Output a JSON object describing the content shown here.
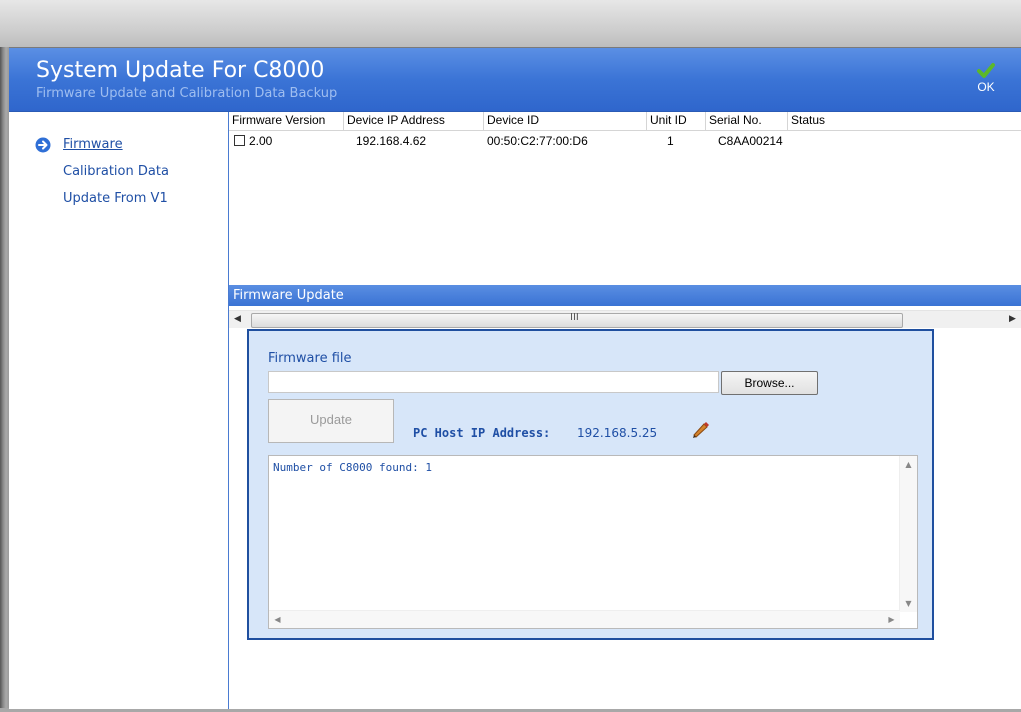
{
  "header": {
    "title": "System Update For C8000",
    "subtitle": "Firmware Update and Calibration Data Backup",
    "ok_label": "OK"
  },
  "sidebar": {
    "items": [
      {
        "label": "Firmware",
        "active": true
      },
      {
        "label": "Calibration Data",
        "active": false
      },
      {
        "label": "Update From V1",
        "active": false
      }
    ]
  },
  "device_table": {
    "columns": [
      "Firmware Version",
      "Device IP Address",
      "Device ID",
      "Unit ID",
      "Serial No.",
      "Status"
    ],
    "rows": [
      {
        "firmware_version": "2.00",
        "checked": false,
        "ip": "192.168.4.62",
        "device_id": "00:50:C2:77:00:D6",
        "unit_id": "1",
        "serial": "C8AA00214",
        "status": ""
      }
    ],
    "scroll_grip": "III"
  },
  "firmware_update": {
    "section_title": "Firmware Update",
    "file_label": "Firmware file",
    "file_value": "",
    "browse_label": "Browse...",
    "update_label": "Update",
    "host_label": "PC Host IP Address:",
    "host_value": "192.168.5.25",
    "log_text": "Number of C8000 found: 1"
  },
  "colors": {
    "header_blue": "#3b74d6",
    "link_blue": "#1f4fa5",
    "panel_bg": "#d7e6f9",
    "panel_border": "#1f4f9f",
    "ok_check": "#5cb82a"
  },
  "icons": {
    "ok": "check-icon",
    "nav_active": "arrow-right-circle-icon",
    "edit": "pencil-icon"
  }
}
